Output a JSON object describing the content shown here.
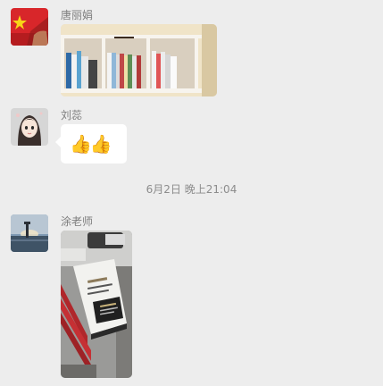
{
  "messages": [
    {
      "sender": "唐丽娟",
      "type": "image",
      "image_desc": "bookshelf-photo"
    },
    {
      "sender": "刘蕊",
      "type": "emoji",
      "emoji": "👍👍"
    },
    {
      "sender": "涂老师",
      "type": "image",
      "image_desc": "books-on-desk-photo"
    }
  ],
  "timestamp": "6月2日 晚上21:04",
  "colors": {
    "background": "#ededed",
    "bubble": "#ffffff",
    "name_text": "#7d7d7d"
  }
}
